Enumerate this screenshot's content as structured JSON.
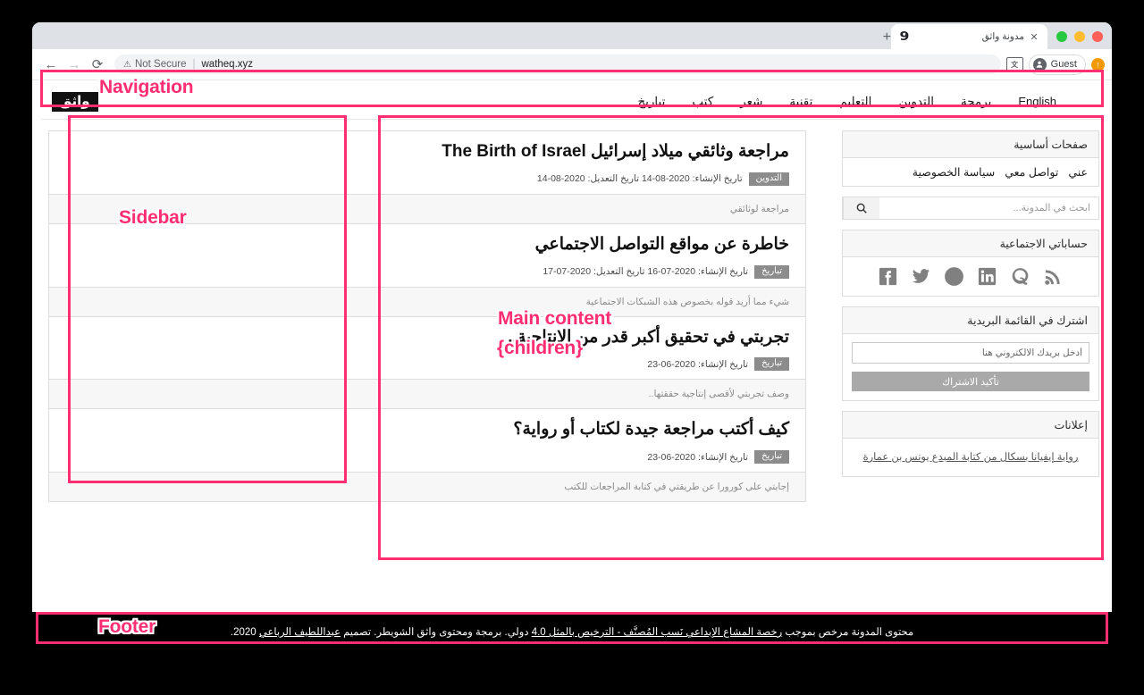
{
  "browser": {
    "tab": {
      "favicon_glyph": "9",
      "title": "مدونة واثق",
      "close_label": "✕"
    },
    "new_tab_label": "+",
    "toolbar": {
      "back_label": "←",
      "forward_label": "→",
      "reload_label": "⟳",
      "security_warning_icon": "⚠",
      "security_label": "Not Secure",
      "separator": "|",
      "url": "watheq.xyz",
      "translate_label": "文",
      "profile_label": "Guest",
      "avatar_glyph": "●",
      "update_glyph": "↑"
    }
  },
  "site": {
    "nav": {
      "logo_text": "واثق",
      "links": [
        {
          "label": "English",
          "latin": true
        },
        {
          "label": "برمجة",
          "latin": false
        },
        {
          "label": "التدوين",
          "latin": false
        },
        {
          "label": "التعليم",
          "latin": false
        },
        {
          "label": "تقنية",
          "latin": false
        },
        {
          "label": "شعر",
          "latin": false
        },
        {
          "label": "كتب",
          "latin": false
        },
        {
          "label": "تباريخ",
          "latin": false
        }
      ]
    },
    "sidebar": {
      "pages_card": {
        "heading": "صفحات أساسية",
        "links": [
          "عني",
          "تواصل معي",
          "سياسة الخصوصية"
        ]
      },
      "search": {
        "placeholder": "ابحث في المدونة...",
        "value": "",
        "icon": "search-icon"
      },
      "social_card": {
        "heading": "حساباتي الاجتماعية",
        "icons": [
          "rss-icon",
          "quora-icon",
          "linkedin-icon",
          "github-icon",
          "twitter-icon",
          "facebook-icon"
        ]
      },
      "newsletter_card": {
        "heading": "اشترك في القائمة البريدية",
        "email_placeholder": "أدخل بريدك الالكتروني هنا",
        "email_value": "",
        "button_label": "تأكيد الاشتراك"
      },
      "ads_card": {
        "heading": "إعلانات",
        "link_text": "رواية إيفيانا بسكال من كتابة المبدع يونس بن عمارة"
      }
    },
    "posts": [
      {
        "title": "مراجعة وثائقي ميلاد إسرائيل The Birth of Israel",
        "badge": "التدوين",
        "meta": "تاريخ الإنشاء: 2020-08-14 تاريخ التعديل: 2020-08-14",
        "excerpt": "مراجعة لوثائقي"
      },
      {
        "title": "خاطرة عن مواقع التواصل الاجتماعي",
        "badge": "تباريخ",
        "meta": "تاريخ الإنشاء: 2020-07-16 تاريخ التعديل: 2020-07-17",
        "excerpt": "شيء مما أريد قوله بخصوص هذه الشبكات الاجتماعية"
      },
      {
        "title": "تجربتي في تحقيق أكبر قدر من الإنتاجية..",
        "badge": "تباريخ",
        "meta": "تاريخ الإنشاء: 2020-06-23",
        "excerpt": "وصف تجربتي لأقصى إنتاجية حققتها.."
      },
      {
        "title": "كيف أكتب مراجعة جيدة لكتاب أو رواية؟",
        "badge": "تباريخ",
        "meta": "تاريخ الإنشاء: 2020-06-23",
        "excerpt": "إجابتي على كورورا عن طريقتي في كتابة المراجعات للكتب"
      }
    ],
    "footer": {
      "prefix": "محتوى المدونة مرخص بموجب ",
      "license_link": "رخصة المشاع الإبداعي نَسب المُصنَّف - الترخيص بالمثل 4.0",
      "middle": " دولي. برمجة ومحتوى واثق الشويطر. تصميم ",
      "designer_link": "عبداللطيف الرباعي",
      "suffix": " 2020."
    }
  },
  "annotations": {
    "navigation": "Navigation",
    "sidebar": "Sidebar",
    "main_content": "Main content",
    "children": "{children}",
    "footer": "Footer",
    "accent_color": "#ff2d72"
  }
}
